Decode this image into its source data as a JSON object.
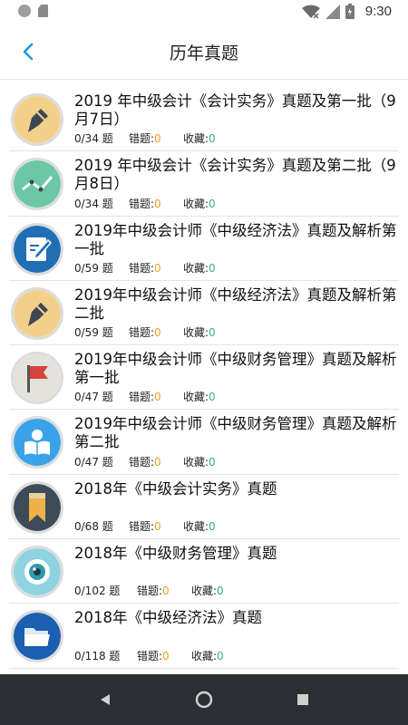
{
  "status_bar": {
    "time": "9:30"
  },
  "header": {
    "title": "历年真题",
    "back_icon": "chevron-left-icon"
  },
  "labels": {
    "count_suffix": "题",
    "errors_label": "错题:",
    "favorites_label": "收藏:"
  },
  "items": [
    {
      "title": "2019 年中级会计《会计实务》真题及第一批（9月7日）",
      "done": "0/34",
      "errors": "0",
      "favorites": "0",
      "icon": "pen-icon",
      "icon_bg": "#f3d08a"
    },
    {
      "title": "2019 年中级会计《会计实务》真题及第二批（9月8日）",
      "done": "0/34",
      "errors": "0",
      "favorites": "0",
      "icon": "line-graph-icon",
      "icon_bg": "#6cc7a7"
    },
    {
      "title": "2019年中级会计师《中级经济法》真题及解析第一批",
      "done": "0/59",
      "errors": "0",
      "favorites": "0",
      "icon": "edit-document-icon",
      "icon_bg": "#1f6fb5"
    },
    {
      "title": "2019年中级会计师《中级经济法》真题及解析第二批",
      "done": "0/59",
      "errors": "0",
      "favorites": "0",
      "icon": "pen-icon",
      "icon_bg": "#f3d08a"
    },
    {
      "title": "2019年中级会计师《中级财务管理》真题及解析第一批",
      "done": "0/47",
      "errors": "0",
      "favorites": "0",
      "icon": "flag-icon",
      "icon_bg": "#e3e3dc"
    },
    {
      "title": "2019年中级会计师《中级财务管理》真题及解析第二批",
      "done": "0/47",
      "errors": "0",
      "favorites": "0",
      "icon": "reader-icon",
      "icon_bg": "#3aa3e8"
    },
    {
      "title": "2018年《中级会计实务》真题",
      "done": "0/68",
      "errors": "0",
      "favorites": "0",
      "icon": "bookmark-icon",
      "icon_bg": "#3d4a57"
    },
    {
      "title": "2018年《中级财务管理》真题",
      "done": "0/102",
      "errors": "0",
      "favorites": "0",
      "icon": "eye-icon",
      "icon_bg": "#8fd3e0"
    },
    {
      "title": "2018年《中级经济法》真题",
      "done": "0/118",
      "errors": "0",
      "favorites": "0",
      "icon": "folder-icon",
      "icon_bg": "#1a5fb0"
    }
  ],
  "colors": {
    "accent": "#1a9bd8",
    "error_count": "#f0a020",
    "favorite_count": "#38b07a",
    "nav_bar": "#2b2f33"
  }
}
